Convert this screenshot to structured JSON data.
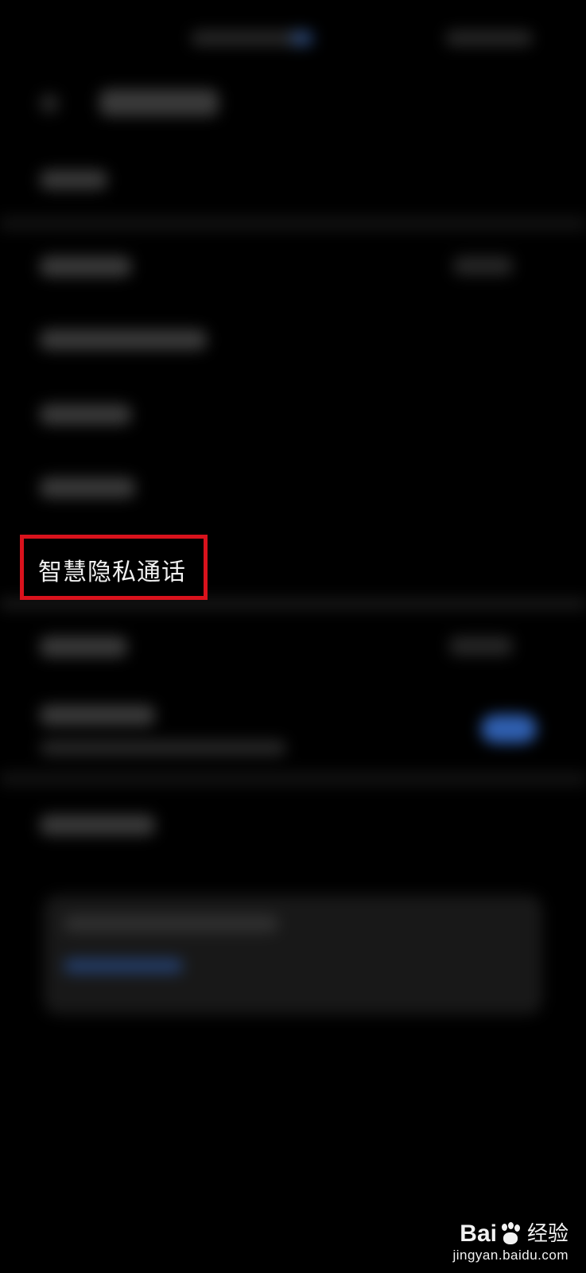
{
  "screen": {
    "background": "#000000",
    "blurred": true
  },
  "highlighted_item": {
    "label": "智慧隐私通话",
    "box_color": "#d9121c"
  },
  "toggle": {
    "state": "on",
    "color": "#2f5fb0"
  },
  "watermark": {
    "brand_left": "Bai",
    "brand_right": "经验",
    "url": "jingyan.baidu.com",
    "icon": "baidu-paw-icon"
  }
}
